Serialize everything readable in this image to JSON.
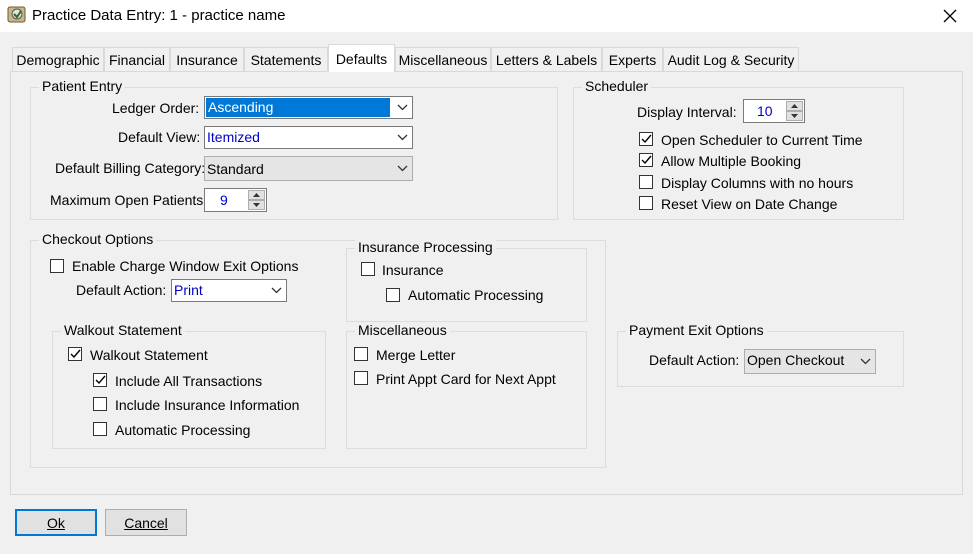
{
  "window": {
    "title": "Practice Data Entry: 1 - practice name"
  },
  "tabs": [
    {
      "label": "Demographic"
    },
    {
      "label": "Financial"
    },
    {
      "label": "Insurance"
    },
    {
      "label": "Statements"
    },
    {
      "label": "Defaults"
    },
    {
      "label": "Miscellaneous"
    },
    {
      "label": "Letters & Labels"
    },
    {
      "label": "Experts"
    },
    {
      "label": "Audit Log & Security"
    }
  ],
  "active_tab": "Defaults",
  "patient_entry": {
    "title": "Patient Entry",
    "ledger_order_label": "Ledger Order:",
    "ledger_order_value": "Ascending",
    "default_view_label": "Default View:",
    "default_view_value": "Itemized",
    "billing_category_label": "Default Billing Category:",
    "billing_category_value": "Standard",
    "max_open_label": "Maximum Open Patients:",
    "max_open_value": "9"
  },
  "scheduler": {
    "title": "Scheduler",
    "display_interval_label": "Display Interval:",
    "display_interval_value": "10",
    "options": [
      {
        "label": "Open Scheduler to Current Time",
        "checked": true
      },
      {
        "label": "Allow Multiple Booking",
        "checked": true
      },
      {
        "label": "Display Columns with no hours",
        "checked": false
      },
      {
        "label": "Reset View on Date Change",
        "checked": false
      }
    ]
  },
  "checkout": {
    "title": "Checkout Options",
    "enable_exit_label": "Enable Charge Window Exit Options",
    "enable_exit_checked": false,
    "default_action_label": "Default Action:",
    "default_action_value": "Print"
  },
  "insurance_processing": {
    "title": "Insurance Processing",
    "insurance_label": "Insurance",
    "insurance_checked": false,
    "auto_label": "Automatic Processing",
    "auto_checked": false
  },
  "walkout": {
    "title": "Walkout Statement",
    "main_label": "Walkout Statement",
    "main_checked": true,
    "options": [
      {
        "label": "Include All Transactions",
        "checked": true
      },
      {
        "label": "Include Insurance Information",
        "checked": false
      },
      {
        "label": "Automatic Processing",
        "checked": false
      }
    ]
  },
  "miscellaneous": {
    "title": "Miscellaneous",
    "options": [
      {
        "label": "Merge Letter",
        "checked": false
      },
      {
        "label": "Print Appt Card for Next Appt",
        "checked": false
      }
    ]
  },
  "payment_exit": {
    "title": "Payment Exit Options",
    "default_action_label": "Default Action:",
    "default_action_value": "Open Checkout"
  },
  "buttons": {
    "ok_label": "Ok",
    "cancel_label": "Cancel"
  }
}
